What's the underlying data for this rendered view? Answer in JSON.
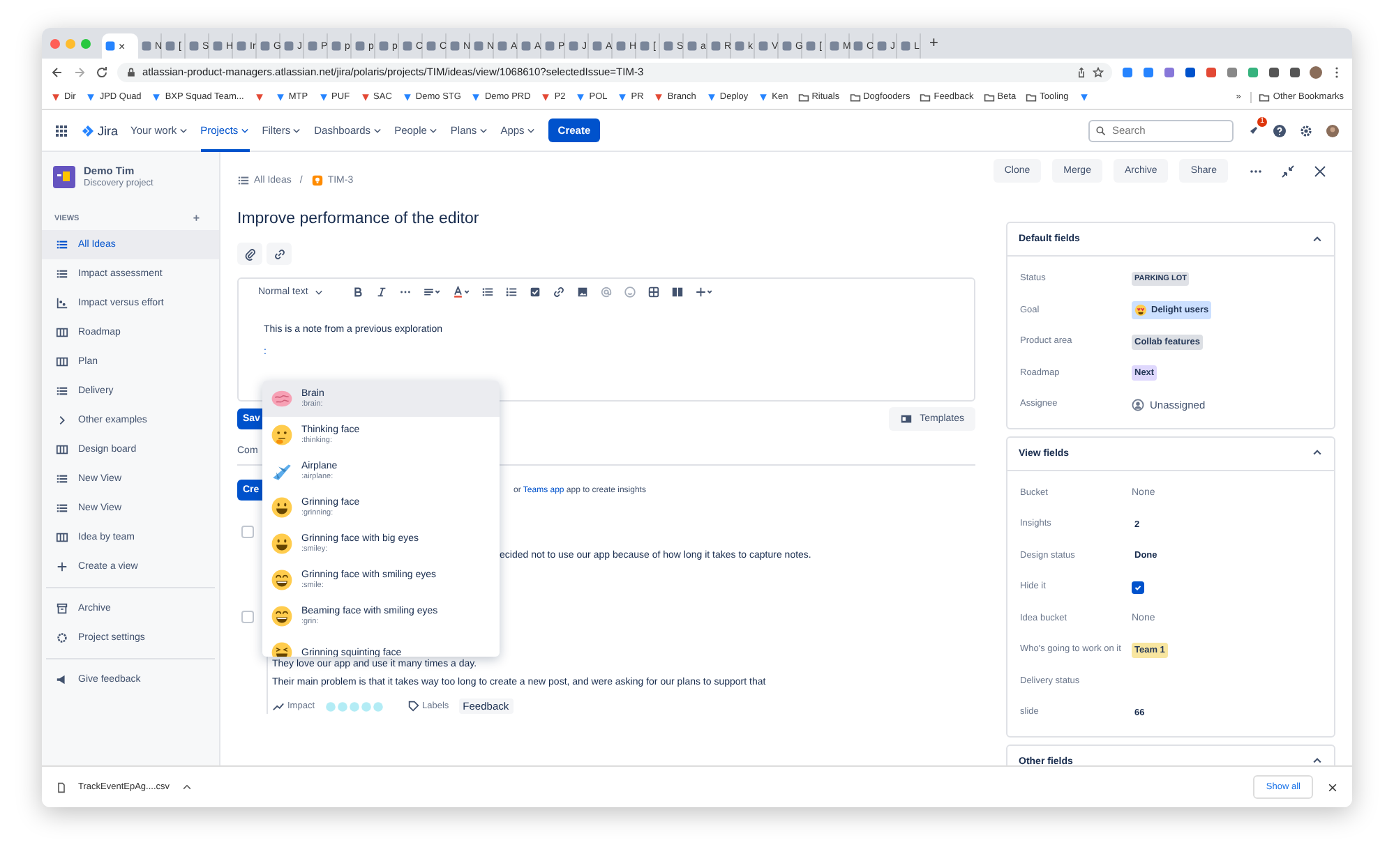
{
  "browser": {
    "tabs": [
      {
        "selected": true,
        "close": "×"
      },
      {
        "title": "N",
        "selected": false
      },
      {
        "title": "[",
        "selected": false
      },
      {
        "title": "S",
        "selected": false
      },
      {
        "title": "H",
        "selected": false
      },
      {
        "title": "Ir",
        "selected": false
      },
      {
        "title": "G",
        "selected": false
      },
      {
        "title": "J",
        "selected": false
      },
      {
        "title": "P",
        "selected": false
      },
      {
        "title": "p",
        "selected": false
      },
      {
        "title": "p",
        "selected": false
      },
      {
        "title": "p",
        "selected": false
      },
      {
        "title": "C",
        "selected": false
      },
      {
        "title": "C",
        "selected": false
      },
      {
        "title": "N",
        "selected": false
      },
      {
        "title": "N",
        "selected": false
      },
      {
        "title": "A",
        "selected": false
      },
      {
        "title": "A",
        "selected": false
      },
      {
        "title": "P",
        "selected": false
      },
      {
        "title": "J",
        "selected": false
      },
      {
        "title": "A",
        "selected": false
      },
      {
        "title": "H",
        "selected": false
      },
      {
        "title": "[",
        "selected": false
      },
      {
        "title": "S",
        "selected": false
      },
      {
        "title": "a",
        "selected": false
      },
      {
        "title": "R",
        "selected": false
      },
      {
        "title": "k",
        "selected": false
      },
      {
        "title": "V",
        "selected": false
      },
      {
        "title": "G",
        "selected": false
      },
      {
        "title": "[",
        "selected": false
      },
      {
        "title": "M",
        "selected": false
      },
      {
        "title": "C",
        "selected": false
      },
      {
        "title": "J",
        "selected": false
      },
      {
        "title": "L",
        "selected": false
      }
    ],
    "new_tab": "+",
    "url": "atlassian-product-managers.atlassian.net/jira/polaris/projects/TIM/ideas/view/1068610?selectedIssue=TIM-3",
    "bookmarks": [
      {
        "label": "Dir",
        "kind": "link"
      },
      {
        "label": "JPD Quad",
        "kind": "link"
      },
      {
        "label": "BXP Squad Team...",
        "kind": "link"
      },
      {
        "kind": "link"
      },
      {
        "label": "MTP",
        "kind": "link"
      },
      {
        "label": "PUF",
        "kind": "link"
      },
      {
        "label": "SAC",
        "kind": "link"
      },
      {
        "label": "Demo STG",
        "kind": "link"
      },
      {
        "label": "Demo PRD",
        "kind": "link"
      },
      {
        "label": "P2",
        "kind": "link"
      },
      {
        "label": "POL",
        "kind": "link"
      },
      {
        "label": "PR",
        "kind": "link"
      },
      {
        "label": "Branch",
        "kind": "link"
      },
      {
        "label": "Deploy",
        "kind": "link"
      },
      {
        "label": "Ken",
        "kind": "link"
      },
      {
        "label": "Rituals",
        "kind": "folder"
      },
      {
        "label": "Dogfooders",
        "kind": "folder"
      },
      {
        "label": "Feedback",
        "kind": "folder"
      },
      {
        "label": "Beta",
        "kind": "folder"
      },
      {
        "label": "Tooling",
        "kind": "folder"
      },
      {
        "kind": "link"
      }
    ],
    "more": "»",
    "other_bookmarks": "Other Bookmarks"
  },
  "nav": {
    "product": "Jira",
    "items": [
      {
        "label": "Your work",
        "selected": false
      },
      {
        "label": "Projects",
        "selected": true
      },
      {
        "label": "Filters",
        "selected": false
      },
      {
        "label": "Dashboards",
        "selected": false
      },
      {
        "label": "People",
        "selected": false
      },
      {
        "label": "Plans",
        "selected": false
      },
      {
        "label": "Apps",
        "selected": false
      }
    ],
    "create": "Create",
    "search": {
      "placeholder": "Search"
    },
    "notifications": "1"
  },
  "sidebar": {
    "project": "Demo Tim",
    "project_type": "Discovery project",
    "views_heading": "VIEWS",
    "add": "+",
    "items": [
      {
        "label": "All Ideas",
        "kind": "list",
        "selected": true
      },
      {
        "label": "Impact assessment",
        "kind": "list",
        "selected": false
      },
      {
        "label": "Impact versus effort",
        "kind": "matrix",
        "selected": false
      },
      {
        "label": "Roadmap",
        "kind": "board",
        "selected": false
      },
      {
        "label": "Plan",
        "kind": "board",
        "selected": false
      },
      {
        "label": "Delivery",
        "kind": "list",
        "selected": false
      },
      {
        "label": "Other examples",
        "kind": "folder",
        "selected": false
      },
      {
        "label": "Design board",
        "kind": "board",
        "selected": false
      },
      {
        "label": "New View",
        "kind": "list",
        "selected": false
      },
      {
        "label": "New View",
        "kind": "list",
        "selected": false
      },
      {
        "label": "Idea by team",
        "kind": "board",
        "selected": false
      },
      {
        "label": "Create a view",
        "kind": "plus",
        "selected": false
      }
    ],
    "footer": [
      {
        "label": "Archive",
        "kind": "archive"
      },
      {
        "label": "Project settings",
        "kind": "gear"
      }
    ],
    "feedback": "Give feedback"
  },
  "idea": {
    "breadcrumb": [
      "All Ideas",
      "TIM-3"
    ],
    "separator": "/",
    "title": "Improve performance of the editor",
    "actions": [
      "Clone",
      "Merge",
      "Archive",
      "Share"
    ],
    "editor": {
      "text_style": "Normal text",
      "body": "This is a note from a previous exploration",
      "typed": ":"
    },
    "save": "Sav",
    "templates": "Templates",
    "comments": "Com",
    "create_insight": "Cre",
    "insights_hint": {
      "before": "or ",
      "link": "Teams app",
      "after": " app to create insights"
    },
    "insights": [
      {
        "checked": false,
        "lines": [
          "ecided not to use our app because of how long it takes to capture notes."
        ]
      },
      {
        "checked": false,
        "lines": [
          "They love our app and use it many times a day.",
          "Their main problem is that it takes way too long to create a new post, and were asking for our plans to support that"
        ]
      }
    ],
    "impact": "Impact",
    "labels": "Labels",
    "label_tag": "Feedback"
  },
  "emoji_menu": [
    {
      "name": "Brain",
      "code": ":brain:",
      "kind": "brain",
      "selected": true
    },
    {
      "name": "Thinking face",
      "code": ":thinking:",
      "kind": "thinking",
      "selected": false
    },
    {
      "name": "Airplane",
      "code": ":airplane:",
      "kind": "airplane",
      "selected": false
    },
    {
      "name": "Grinning face",
      "code": ":grinning:",
      "kind": "grin",
      "selected": false
    },
    {
      "name": "Grinning face with big eyes",
      "code": ":smiley:",
      "kind": "grin",
      "selected": false
    },
    {
      "name": "Grinning face with smiling eyes",
      "code": ":smile:",
      "kind": "smile",
      "selected": false
    },
    {
      "name": "Beaming face with smiling eyes",
      "code": ":grin:",
      "kind": "smile",
      "selected": false
    },
    {
      "name": "Grinning squinting face",
      "kind": "squint",
      "selected": false
    }
  ],
  "panels": [
    {
      "title": "Default fields",
      "expanded": true,
      "fields": [
        {
          "label": "Status",
          "kind": "status",
          "value": "PARKING LOT",
          "color": "#dfe1e6"
        },
        {
          "label": "Goal",
          "kind": "emoji-tag",
          "value": "Delight users",
          "color": "#cce0ff"
        },
        {
          "label": "Product area",
          "kind": "tag",
          "value": "Collab features",
          "color": "#dcdfe4"
        },
        {
          "label": "Roadmap",
          "kind": "tag",
          "value": "Next",
          "color": "#dfd8fd"
        },
        {
          "label": "Assignee",
          "kind": "user",
          "value": "Unassigned"
        }
      ]
    },
    {
      "title": "View fields",
      "expanded": true,
      "fields": [
        {
          "label": "Bucket",
          "kind": "text",
          "value": "None"
        },
        {
          "label": "Insights",
          "kind": "bold",
          "value": "2"
        },
        {
          "label": "Design status",
          "kind": "bold",
          "value": "Done"
        },
        {
          "label": "Hide it",
          "kind": "checkbox",
          "checked": true
        },
        {
          "label": "Idea bucket",
          "kind": "text",
          "value": "None"
        },
        {
          "label": "Who's going to work on it",
          "kind": "tag",
          "value": "Team 1",
          "color": "#f8e6a0"
        },
        {
          "label": "Delivery status",
          "kind": "empty"
        },
        {
          "label": "slide",
          "kind": "bold",
          "value": "66"
        }
      ]
    },
    {
      "title": "Other fields",
      "expanded": true
    }
  ],
  "download": {
    "file": "TrackEventEpAg....csv",
    "show_all": "Show all"
  }
}
